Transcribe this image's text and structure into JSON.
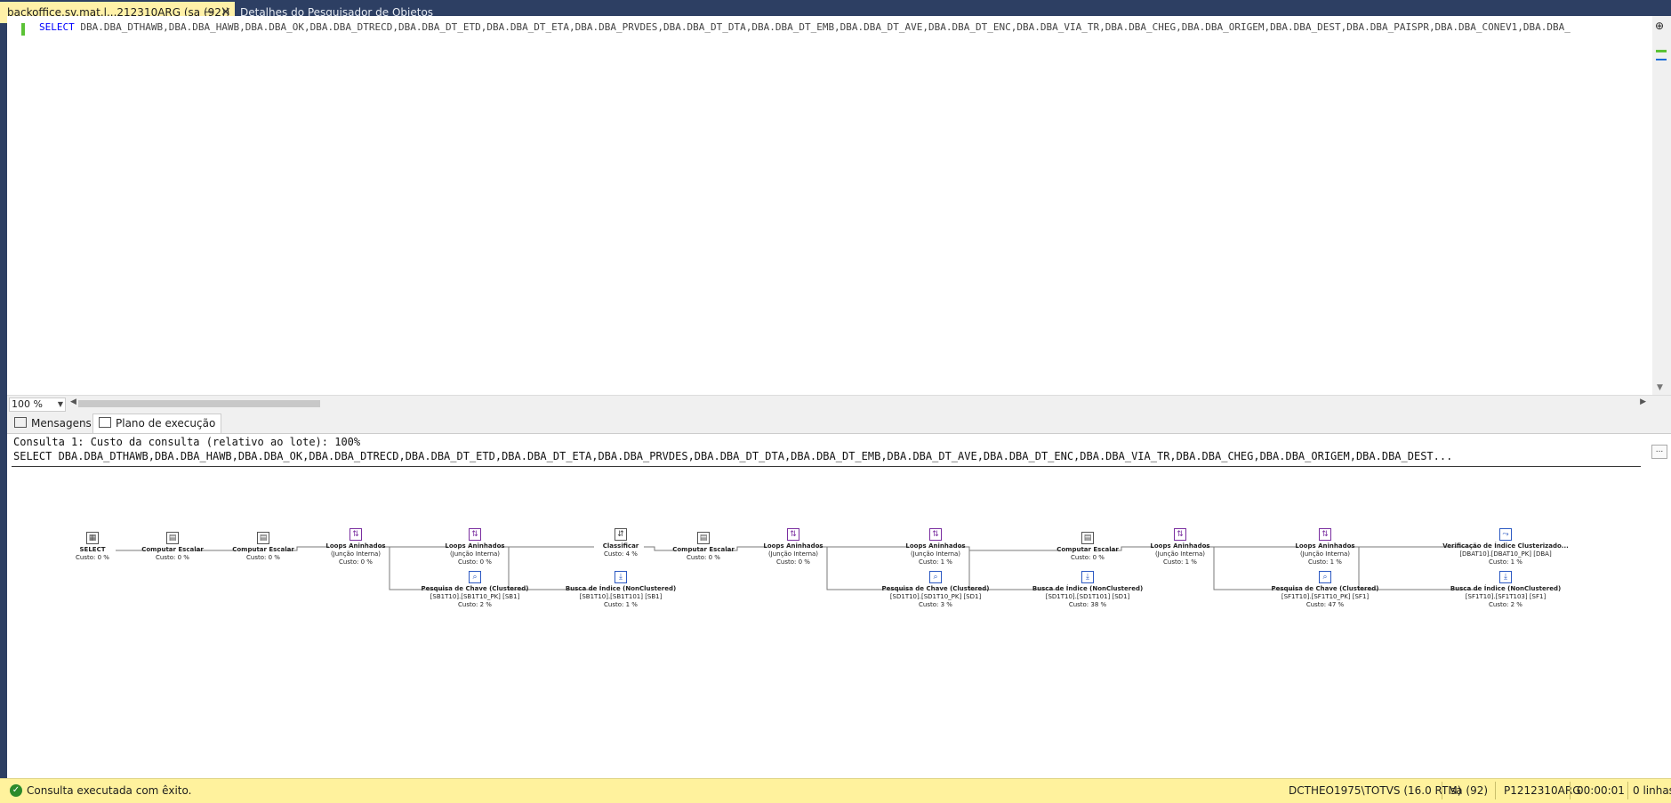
{
  "tabs": {
    "active_title": "backoffice.sv.mat.l...212310ARG (sa (92))",
    "pin_glyph": "⊸",
    "close_glyph": "✕",
    "inactive_title": "Detalhes do Pesquisador de Objetos"
  },
  "editor": {
    "keyword": "SELECT",
    "code": " DBA.DBA_DTHAWB,DBA.DBA_HAWB,DBA.DBA_OK,DBA.DBA_DTRECD,DBA.DBA_DT_ETD,DBA.DBA_DT_ETA,DBA.DBA_PRVDES,DBA.DBA_DT_DTA,DBA.DBA_DT_EMB,DBA.DBA_DT_AVE,DBA.DBA_DT_ENC,DBA.DBA_VIA_TR,DBA.DBA_CHEG,DBA.DBA_ORIGEM,DBA.DBA_DEST,DBA.DBA_PAISPR,DBA.DBA_CONEV1,DBA.DBA_",
    "zoom": "100 %"
  },
  "results_tabs": {
    "messages": "Mensagens",
    "plan": "Plano de execução"
  },
  "plan": {
    "header1": "Consulta 1: Custo da consulta (relativo ao lote): 100%",
    "header2": "SELECT DBA.DBA_DTHAWB,DBA.DBA_HAWB,DBA.DBA_OK,DBA.DBA_DTRECD,DBA.DBA_DT_ETD,DBA.DBA_DT_ETA,DBA.DBA_PRVDES,DBA.DBA_DT_DTA,DBA.DBA_DT_EMB,DBA.DBA_DT_AVE,DBA.DBA_DT_ENC,DBA.DBA_VIA_TR,DBA.DBA_CHEG,DBA.DBA_ORIGEM,DBA.DBA_DEST...",
    "ellipsis": "...",
    "nodes": [
      {
        "lines": [
          "SELECT",
          "Custo: 0 %"
        ],
        "icon": "select-icon",
        "glyph": "▦",
        "tone": "gray"
      },
      {
        "lines": [
          "Computar Escalar",
          "Custo: 0 %"
        ],
        "icon": "compute-scalar-icon",
        "glyph": "▤",
        "tone": "gray"
      },
      {
        "lines": [
          "Computar Escalar",
          "Custo: 0 %"
        ],
        "icon": "compute-scalar-icon",
        "glyph": "▤",
        "tone": "gray"
      },
      {
        "lines": [
          "Loops Aninhados",
          "(Junção Interna)",
          "Custo: 0 %"
        ],
        "icon": "nested-loops-icon",
        "glyph": "⇅",
        "tone": "purple"
      },
      {
        "lines": [
          "Loops Aninhados",
          "(Junção Interna)",
          "Custo: 0 %"
        ],
        "icon": "nested-loops-icon",
        "glyph": "⇅",
        "tone": "purple"
      },
      {
        "lines": [
          "Pesquisa de Chave (Clustered)",
          "[SB1T10].[SB1T10_PK] [SB1]",
          "Custo: 2 %"
        ],
        "icon": "key-lookup-icon",
        "glyph": "⌕",
        "tone": "blue"
      },
      {
        "lines": [
          "Classificar",
          "Custo: 4 %"
        ],
        "icon": "sort-icon",
        "glyph": "⇵",
        "tone": "gray"
      },
      {
        "lines": [
          "Busca de Índice (NonClustered)",
          "[SB1T10].[SB1T101] [SB1]",
          "Custo: 1 %"
        ],
        "icon": "index-seek-icon",
        "glyph": "⤓",
        "tone": "blue"
      },
      {
        "lines": [
          "Computar Escalar",
          "Custo: 0 %"
        ],
        "icon": "compute-scalar-icon",
        "glyph": "▤",
        "tone": "gray"
      },
      {
        "lines": [
          "Loops Aninhados",
          "(Junção Interna)",
          "Custo: 0 %"
        ],
        "icon": "nested-loops-icon",
        "glyph": "⇅",
        "tone": "purple"
      },
      {
        "lines": [
          "Loops Aninhados",
          "(Junção Interna)",
          "Custo: 1 %"
        ],
        "icon": "nested-loops-icon",
        "glyph": "⇅",
        "tone": "purple"
      },
      {
        "lines": [
          "Pesquisa de Chave (Clustered)",
          "[SD1T10].[SD1T10_PK] [SD1]",
          "Custo: 3 %"
        ],
        "icon": "key-lookup-icon",
        "glyph": "⌕",
        "tone": "blue"
      },
      {
        "lines": [
          "Computar Escalar",
          "Custo: 0 %"
        ],
        "icon": "compute-scalar-icon",
        "glyph": "▤",
        "tone": "gray"
      },
      {
        "lines": [
          "Busca de Índice (NonClustered)",
          "[SD1T10].[SD1T101] [SD1]",
          "Custo: 38 %"
        ],
        "icon": "index-seek-icon",
        "glyph": "⤓",
        "tone": "blue"
      },
      {
        "lines": [
          "Loops Aninhados",
          "(Junção Interna)",
          "Custo: 1 %"
        ],
        "icon": "nested-loops-icon",
        "glyph": "⇅",
        "tone": "purple"
      },
      {
        "lines": [
          "Loops Aninhados",
          "(Junção Interna)",
          "Custo: 1 %"
        ],
        "icon": "nested-loops-icon",
        "glyph": "⇅",
        "tone": "purple"
      },
      {
        "lines": [
          "Pesquisa de Chave (Clustered)",
          "[SF1T10].[SF1T10_PK] [SF1]",
          "Custo: 47 %"
        ],
        "icon": "key-lookup-icon",
        "glyph": "⌕",
        "tone": "blue"
      },
      {
        "lines": [
          "Verificação de Índice Clusterizado...",
          "[DBAT10].[DBAT10_PK] [DBA]",
          "Custo: 1 %"
        ],
        "icon": "clustered-index-scan-icon",
        "glyph": "⤳",
        "tone": "blue"
      },
      {
        "lines": [
          "Busca de Índice (NonClustered)",
          "[SF1T10].[SF1T103] [SF1]",
          "Custo: 2 %"
        ],
        "icon": "index-seek-icon",
        "glyph": "⤓",
        "tone": "blue"
      }
    ]
  },
  "status": {
    "ok_glyph": "✓",
    "message": "Consulta executada com êxito.",
    "server": "DCTHEO1975\\TOTVS (16.0 RTM)",
    "user": "sa (92)",
    "database": "P1212310ARG",
    "elapsed": "00:00:01",
    "rows": "0 linhas"
  }
}
